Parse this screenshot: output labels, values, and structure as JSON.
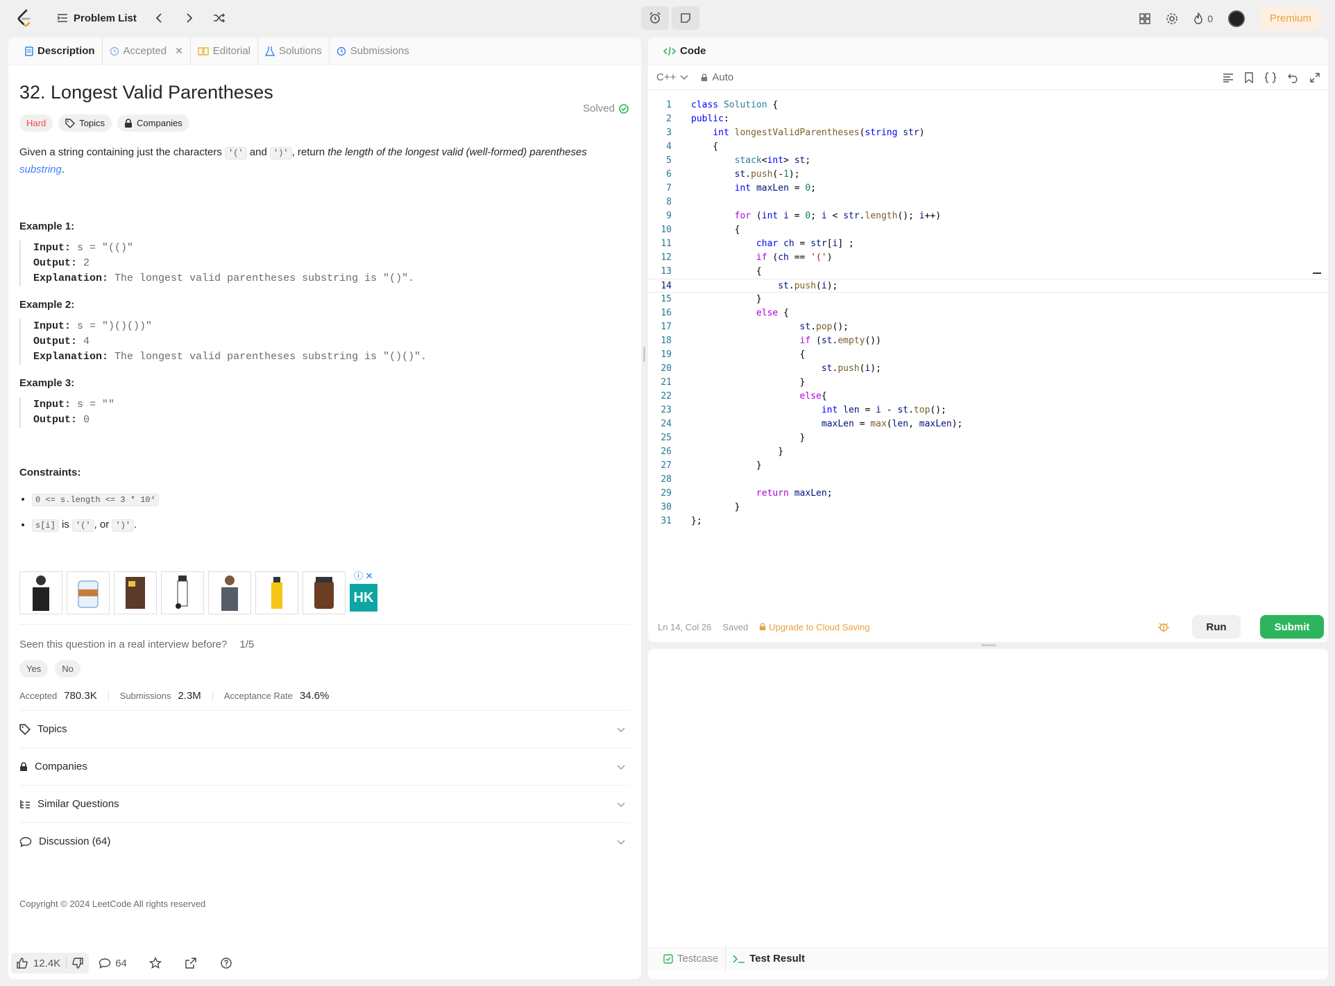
{
  "topbar": {
    "problem_list_label": "Problem List",
    "streak_count": "0",
    "premium_label": "Premium"
  },
  "desc_tabs": [
    {
      "label": "Description"
    },
    {
      "label": "Accepted"
    },
    {
      "label": "Editorial"
    },
    {
      "label": "Solutions"
    },
    {
      "label": "Submissions"
    }
  ],
  "problem": {
    "title": "32. Longest Valid Parentheses",
    "solved_label": "Solved",
    "difficulty": "Hard",
    "topics_chip": "Topics",
    "companies_chip": "Companies",
    "statement_prefix": "Given a string containing just the characters ",
    "statement_code1": "'('",
    "statement_and": " and ",
    "statement_code2": "')'",
    "statement_mid": ", return ",
    "statement_em": "the length of the longest valid (well-formed) parentheses",
    "statement_link": "substring",
    "statement_end": "."
  },
  "examples": [
    {
      "heading": "Example 1:",
      "input_label": "Input:",
      "input": "s = \"(()\"",
      "output_label": "Output:",
      "output": "2",
      "expl_label": "Explanation:",
      "expl": "The longest valid parentheses substring is \"()\"."
    },
    {
      "heading": "Example 2:",
      "input_label": "Input:",
      "input": "s = \")()())\"",
      "output_label": "Output:",
      "output": "4",
      "expl_label": "Explanation:",
      "expl": "The longest valid parentheses substring is \"()()\"."
    },
    {
      "heading": "Example 3:",
      "input_label": "Input:",
      "input": "s = \"\"",
      "output_label": "Output:",
      "output": "0"
    }
  ],
  "constraints": {
    "heading": "Constraints:",
    "c1": "0 <= s.length <= 3 * 10⁴",
    "c2_code": "s[i]",
    "c2_is": " is ",
    "c2_a": "'('",
    "c2_or": ", or ",
    "c2_b": "')'",
    "c2_end": "."
  },
  "ad": {
    "logo_text": "HK"
  },
  "interview": {
    "question": "Seen this question in a real interview before?",
    "count": "1/5",
    "yes": "Yes",
    "no": "No"
  },
  "stats": {
    "accepted_label": "Accepted",
    "accepted_value": "780.3K",
    "submissions_label": "Submissions",
    "submissions_value": "2.3M",
    "rate_label": "Acceptance Rate",
    "rate_value": "34.6%"
  },
  "accordions": [
    {
      "label": "Topics"
    },
    {
      "label": "Companies"
    },
    {
      "label": "Similar Questions"
    },
    {
      "label": "Discussion (64)"
    }
  ],
  "copyright": "Copyright © 2024 LeetCode All rights reserved",
  "bottom": {
    "likes": "12.4K",
    "comments": "64"
  },
  "code_panel": {
    "tab_label": "Code",
    "language": "C++",
    "auto_label": "Auto",
    "status_pos": "Ln 14, Col 26",
    "status_saved": "Saved",
    "upgrade_label": "Upgrade to Cloud Saving",
    "run_label": "Run",
    "submit_label": "Submit"
  },
  "code_lines": [
    "class Solution {",
    "public:",
    "    int longestValidParentheses(string str)",
    "    {",
    "        stack<int> st;",
    "        st.push(-1);",
    "        int maxLen = 0;",
    "",
    "        for (int i = 0; i < str.length(); i++)",
    "        {",
    "            char ch = str[i] ;",
    "            if (ch == '(')",
    "            {",
    "                st.push(i);",
    "            }",
    "            else {",
    "                    st.pop();",
    "                    if (st.empty())",
    "                    {",
    "                        st.push(i);",
    "                    }",
    "                    else{",
    "                        int len = i - st.top();",
    "                        maxLen = max(len, maxLen);",
    "                    }",
    "                }",
    "            }",
    "",
    "            return maxLen;",
    "        }",
    "};"
  ],
  "current_line": 14,
  "result_tabs": [
    {
      "label": "Testcase"
    },
    {
      "label": "Test Result"
    }
  ],
  "colors": {
    "hard": "#ef4743",
    "accent_green": "#2db55d",
    "premium": "#e8a13d",
    "link": "#3b82f6"
  }
}
